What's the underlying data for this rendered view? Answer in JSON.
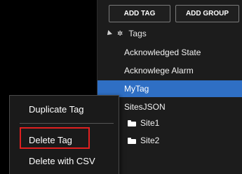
{
  "toolbar": {
    "add_tag_label": "ADD TAG",
    "add_group_label": "ADD GROUP"
  },
  "tree": {
    "root_label": "Tags",
    "items": [
      {
        "label": "Acknowledged State",
        "selected": false
      },
      {
        "label": "Acknowlege Alarm",
        "selected": false
      },
      {
        "label": "MyTag",
        "selected": true
      },
      {
        "label": "SitesJSON",
        "selected": false
      }
    ],
    "folders": [
      {
        "label": "Site1"
      },
      {
        "label": "Site2"
      }
    ]
  },
  "context_menu": {
    "items": [
      {
        "label": "Duplicate Tag"
      },
      {
        "label": "Delete Tag",
        "highlighted": true
      },
      {
        "label": "Delete with CSV"
      }
    ]
  },
  "colors": {
    "selection": "#2f6fc4",
    "highlight_box": "#e02020",
    "panel_bg": "#1c1c1c",
    "button_border": "#7a7a7a"
  },
  "icons": {
    "root_expand": "caret-down-icon",
    "root_gear": "gear-icon",
    "folder": "folder-icon"
  }
}
